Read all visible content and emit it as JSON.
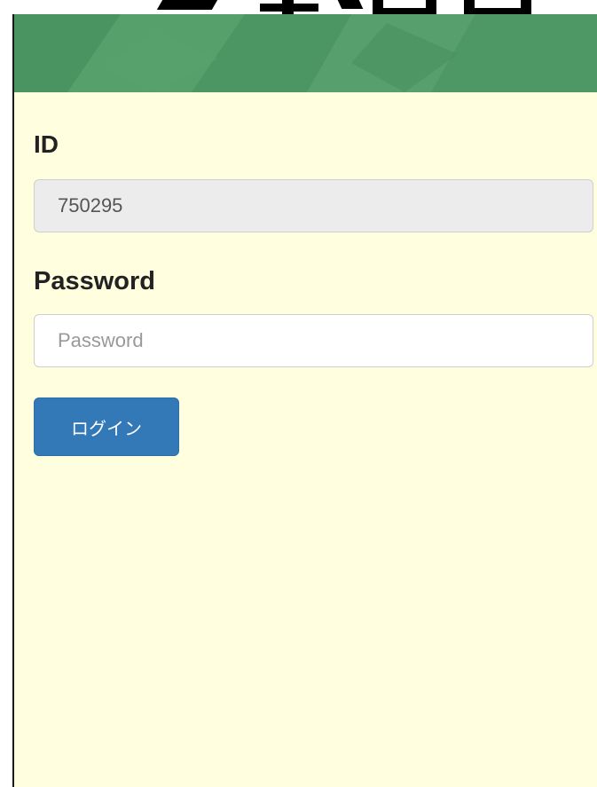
{
  "form": {
    "id_label": "ID",
    "id_value": "750295",
    "password_label": "Password",
    "password_placeholder": "Password",
    "login_button_label": "ログイン"
  },
  "colors": {
    "header_green": "#4f9a66",
    "panel_background": "#ffffe0",
    "readonly_input_background": "#ececec",
    "button_blue": "#3479b7"
  }
}
